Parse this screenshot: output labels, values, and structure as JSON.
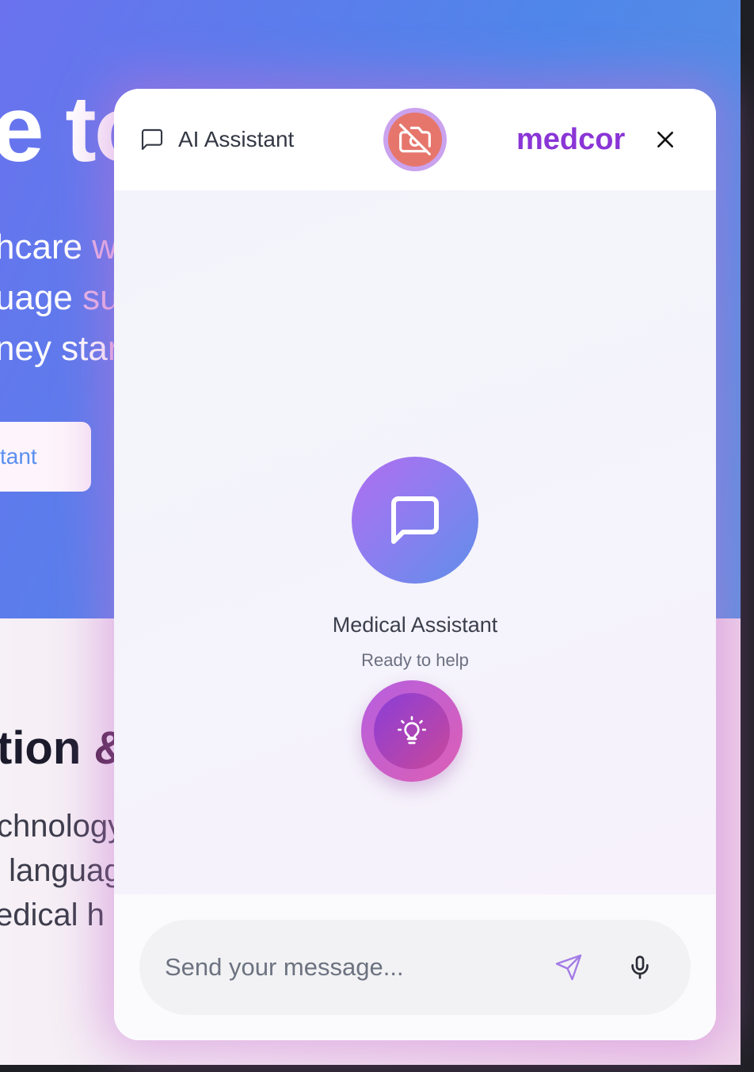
{
  "background_page": {
    "hero_title_fragment": "e to",
    "hero_subtitle_lines": [
      {
        "main": "hcare ",
        "faded": "w"
      },
      {
        "main": "uage ",
        "faded": "su"
      },
      {
        "main": "ney sta",
        "faded": "r"
      }
    ],
    "hero_button_fragment": "tant",
    "section_title_fragment": "tion ",
    "section_title_amp": "&",
    "section_text_lines": [
      "chnology",
      " languag",
      "edical h"
    ]
  },
  "widget": {
    "header": {
      "title": "AI Assistant",
      "chat_icon": "message-square-icon",
      "camera_icon": "camera-off-icon",
      "brand": "medcor",
      "close_icon": "close-icon"
    },
    "body": {
      "avatar_icon": "message-square-icon",
      "assistant_name": "Medical Assistant",
      "assistant_status": "Ready to help",
      "suggestion_icon": "lightbulb-icon"
    },
    "input": {
      "placeholder": "Send your message...",
      "value": "",
      "send_icon": "send-icon",
      "mic_icon": "microphone-icon"
    }
  },
  "colors": {
    "brand": "#8a35d6",
    "hero_gradient_start": "#6a72ee",
    "hero_gradient_end": "#4f86ea",
    "camera_badge": "#e6766c",
    "status_bar_border": "#8e3fd0"
  }
}
